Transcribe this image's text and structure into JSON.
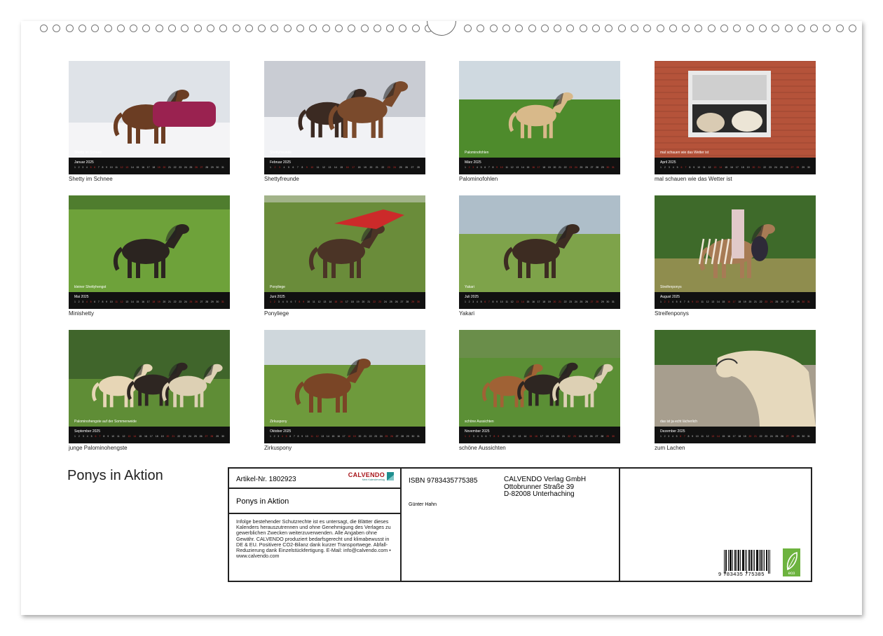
{
  "calendar_title": "Ponys in Aktion",
  "months": [
    {
      "name": "Januar 2025",
      "caption": "Shetty im Schnee",
      "inner": "Shetty im Schnee"
    },
    {
      "name": "Februar 2025",
      "caption": "Shettyfreunde",
      "inner": "Shettyfreunde"
    },
    {
      "name": "März 2025",
      "caption": "Palominofohlen",
      "inner": "Palominofohlen"
    },
    {
      "name": "April 2025",
      "caption": "mal schauen wie das Wetter ist",
      "inner": "mal schauen wie das Wetter ist"
    },
    {
      "name": "Mai 2025",
      "caption": "Minishetty",
      "inner": "kleiner Shettyhengst"
    },
    {
      "name": "Juni 2025",
      "caption": "Ponyliege",
      "inner": "Ponyliege"
    },
    {
      "name": "Juli 2025",
      "caption": "Yakari",
      "inner": "Yakari"
    },
    {
      "name": "August 2025",
      "caption": "Streifenponys",
      "inner": "Streifenponys"
    },
    {
      "name": "September 2025",
      "caption": "junge Palominohengste",
      "inner": "Palominohengste auf der Sommerweide"
    },
    {
      "name": "Oktober 2025",
      "caption": "Zirkuspony",
      "inner": "Zirkuspony"
    },
    {
      "name": "November 2025",
      "caption": "schöne Aussichten",
      "inner": "schöne Aussichten"
    },
    {
      "name": "Dezember 2025",
      "caption": "zum Lachen",
      "inner": "das ist ja echt lächerlich"
    }
  ],
  "info": {
    "article": "Artikel-Nr. 1802923",
    "logo": "CALVENDO",
    "logo_sub": "Mein Kalenderverlag",
    "title": "Ponys in Aktion",
    "legal": "Infolge bestehender Schutzrechte ist es untersagt, die Blätter dieses Kalenders herauszutrennen und ohne Genehmigung des Verlages zu gewerblichen Zwecken weiterzuverwenden. Alle Angaben ohne Gewähr. CALVENDO produziert bedarfsgerecht und klimabewusst in DE & EU. Positivere CO2-Bilanz dank kurzer Transportwege. Abfall-Reduzierung dank Einzelstückfertigung. E-Mail: info@calvendo.com • www.calvendo.com",
    "isbn": "ISBN 9783435775385",
    "publisher_name": "CALVENDO Verlag GmbH",
    "publisher_street": "Ottobrunner Straße 39",
    "publisher_city": "D-82008 Unterhaching",
    "author": "Günter Hahn",
    "barcode_number": "9 783435 775385",
    "eco_label": "eco"
  },
  "colors": {
    "strip": "#111111",
    "weekend": "#d9302c",
    "border": "#222222",
    "logo_red": "#a8161b",
    "eco_green": "#6db33f"
  }
}
